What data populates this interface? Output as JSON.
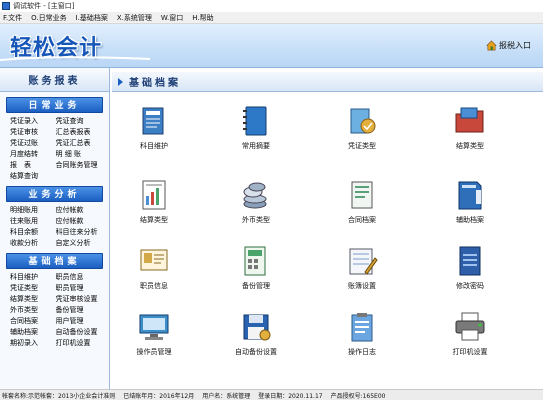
{
  "window": {
    "title": "调试软件 - [主窗口]"
  },
  "menu": [
    "F.文件",
    "O.日常业务",
    "I.基础档案",
    "X.系统管理",
    "W.窗口",
    "H.帮助"
  ],
  "banner": {
    "logo": "轻松会计",
    "report_entry": "报税入口"
  },
  "sidebar": {
    "title": "账务报表",
    "groups": [
      {
        "title": "日常业务",
        "items": [
          "凭证录入",
          "凭证查询",
          "凭证审核",
          "汇总表报表",
          "凭证过账",
          "凭证汇总表",
          "月度结转",
          "明 细 账",
          "报　表",
          "合同账务管理",
          "结算查询"
        ]
      },
      {
        "title": "业务分析",
        "items": [
          "明细账用",
          "应付帐款",
          "往来账用",
          "应付帐款",
          "科目余额",
          "科目往来分析",
          "收款分析",
          "自定义分析"
        ]
      },
      {
        "title": "基础档案",
        "items": [
          "科目维护",
          "职员信息",
          "凭证类型",
          "职员管理",
          "结算类型",
          "凭证审核设置",
          "外币类型",
          "备份管理",
          "合同档案",
          "用户管理",
          "辅助档案",
          "自动备份设置",
          "期初录入",
          "打印机设置"
        ]
      }
    ]
  },
  "main": {
    "title": "基础档案",
    "tiles": [
      {
        "label": "科目维护",
        "icon": "book-account-icon",
        "color": "#3d7fc4"
      },
      {
        "label": "常用摘要",
        "icon": "notebook-icon",
        "color": "#2e78c8"
      },
      {
        "label": "凭证类型",
        "icon": "voucher-type-icon",
        "color": "#6bb0e0"
      },
      {
        "label": "结算类型",
        "icon": "folder-settle-icon",
        "color": "#c9483c"
      },
      {
        "label": "结算类型",
        "icon": "document-chart-icon",
        "color": "#4a8fd4"
      },
      {
        "label": "外币类型",
        "icon": "coins-icon",
        "color": "#8aa0b8"
      },
      {
        "label": "合同档案",
        "icon": "contract-icon",
        "color": "#5aa07a"
      },
      {
        "label": "辅助档案",
        "icon": "auxiliary-book-icon",
        "color": "#2f6eb8"
      },
      {
        "label": "职员信息",
        "icon": "staff-card-icon",
        "color": "#d2a848"
      },
      {
        "label": "备份管理",
        "icon": "backup-calc-icon",
        "color": "#49a36a"
      },
      {
        "label": "账簿设置",
        "icon": "ledger-pen-icon",
        "color": "#7a9ccc"
      },
      {
        "label": "修改密码",
        "icon": "password-book-icon",
        "color": "#2f5fa8"
      },
      {
        "label": "操作员管理",
        "icon": "operator-monitor-icon",
        "color": "#3d8fc9"
      },
      {
        "label": "自动备份设置",
        "icon": "floppy-disk-icon",
        "color": "#2a64b0"
      },
      {
        "label": "操作日志",
        "icon": "log-clipboard-icon",
        "color": "#6ca6e0"
      },
      {
        "label": "打印机设置",
        "icon": "printer-icon",
        "color": "#7a7a7a"
      }
    ]
  },
  "status": [
    "帐套名称:示范帐套：2013小企业会计准则",
    "已结账年月：2016年12月",
    "用户名：系统管理",
    "登录日期：2020.11.17",
    "产品授权号:165E00"
  ]
}
